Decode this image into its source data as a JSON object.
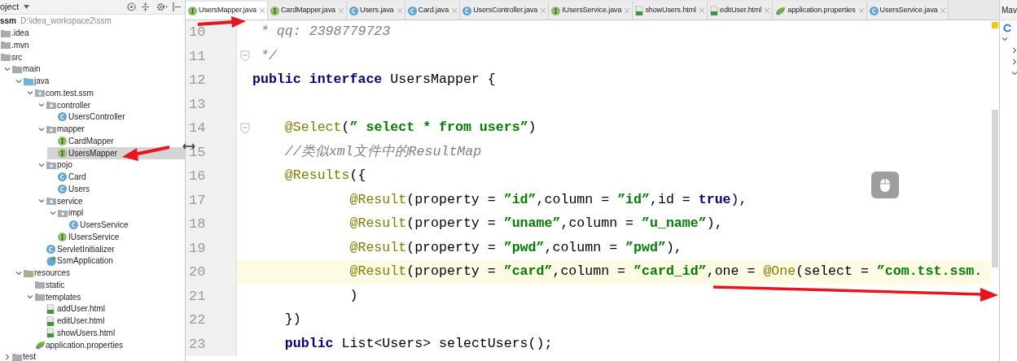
{
  "project_panel": {
    "title": "oject",
    "tree": [
      {
        "label": "ssm",
        "path": "D:\\idea_workspace2\\ssm",
        "kind": "module",
        "selected": false,
        "children": [
          {
            "label": ".idea",
            "kind": "folder",
            "selected": false
          },
          {
            "label": ".mvn",
            "kind": "folder",
            "selected": false
          },
          {
            "label": "src",
            "kind": "folder",
            "selected": false,
            "children": [
              {
                "label": "main",
                "kind": "folder",
                "selected": false,
                "expanded": true,
                "children": [
                  {
                    "label": "java",
                    "kind": "source",
                    "selected": false,
                    "expanded": true,
                    "children": [
                      {
                        "label": "com.test.ssm",
                        "kind": "package",
                        "selected": false,
                        "expanded": true,
                        "children": [
                          {
                            "label": "controller",
                            "kind": "package",
                            "selected": false,
                            "expanded": true,
                            "children": [
                              {
                                "label": "UsersController",
                                "kind": "class",
                                "selected": false
                              }
                            ]
                          },
                          {
                            "label": "mapper",
                            "kind": "package",
                            "selected": false,
                            "expanded": true,
                            "children": [
                              {
                                "label": "CardMapper",
                                "kind": "interface",
                                "selected": false
                              },
                              {
                                "label": "UsersMapper",
                                "kind": "interface",
                                "selected": true
                              }
                            ]
                          },
                          {
                            "label": "pojo",
                            "kind": "package",
                            "selected": false,
                            "expanded": true,
                            "children": [
                              {
                                "label": "Card",
                                "kind": "class",
                                "selected": false
                              },
                              {
                                "label": "Users",
                                "kind": "class",
                                "selected": false
                              }
                            ]
                          },
                          {
                            "label": "service",
                            "kind": "package",
                            "selected": false,
                            "expanded": true,
                            "children": [
                              {
                                "label": "impl",
                                "kind": "package",
                                "selected": false,
                                "expanded": true,
                                "children": [
                                  {
                                    "label": "UsersService",
                                    "kind": "class",
                                    "selected": false
                                  }
                                ]
                              },
                              {
                                "label": "IUsersService",
                                "kind": "interface",
                                "selected": false
                              }
                            ]
                          },
                          {
                            "label": "ServletInitializer",
                            "kind": "class",
                            "selected": false
                          },
                          {
                            "label": "SsmApplication",
                            "kind": "app",
                            "selected": false
                          }
                        ]
                      }
                    ]
                  },
                  {
                    "label": "resources",
                    "kind": "resources",
                    "selected": false,
                    "expanded": true,
                    "children": [
                      {
                        "label": "static",
                        "kind": "folder",
                        "selected": false
                      },
                      {
                        "label": "templates",
                        "kind": "folder",
                        "selected": false,
                        "expanded": true,
                        "children": [
                          {
                            "label": "addUser.html",
                            "kind": "html",
                            "selected": false
                          },
                          {
                            "label": "editUser.html",
                            "kind": "html",
                            "selected": false
                          },
                          {
                            "label": "showUsers.html",
                            "kind": "html",
                            "selected": false
                          }
                        ]
                      },
                      {
                        "label": "application.properties",
                        "kind": "spring",
                        "selected": false
                      }
                    ]
                  }
                ]
              },
              {
                "label": "test",
                "kind": "folder",
                "selected": false,
                "expanded": false
              }
            ]
          }
        ]
      }
    ]
  },
  "editor": {
    "tabs": [
      {
        "label": "UsersMapper.java",
        "kind": "interface",
        "selected": true
      },
      {
        "label": "CardMapper.java",
        "kind": "interface",
        "selected": false
      },
      {
        "label": "Users.java",
        "kind": "class",
        "selected": false
      },
      {
        "label": "Card.java",
        "kind": "class",
        "selected": false
      },
      {
        "label": "UsersController.java",
        "kind": "class",
        "selected": false
      },
      {
        "label": "IUsersService.java",
        "kind": "interface",
        "selected": false
      },
      {
        "label": "showUsers.html",
        "kind": "html",
        "selected": false
      },
      {
        "label": "editUser.html",
        "kind": "html",
        "selected": false
      },
      {
        "label": "application.properties",
        "kind": "spring",
        "selected": false
      },
      {
        "label": "UsersService.java",
        "kind": "class",
        "selected": false
      }
    ],
    "lines": [
      {
        "number": "10",
        "current": false,
        "fold": false,
        "tokens": [
          {
            "text": " * qq: 2398779723",
            "kind": "comment"
          }
        ]
      },
      {
        "number": "11",
        "current": false,
        "fold": true,
        "tokens": [
          {
            "text": " */",
            "kind": "comment"
          }
        ]
      },
      {
        "number": "12",
        "current": false,
        "fold": false,
        "tokens": [
          {
            "text": "public interface",
            "kind": "keyword"
          },
          {
            "text": " UsersMapper {",
            "kind": "plain"
          }
        ]
      },
      {
        "number": "13",
        "current": false,
        "fold": false
      },
      {
        "number": "14",
        "current": false,
        "fold": true,
        "tokens": [
          {
            "text": "    @Select",
            "kind": "annotation"
          },
          {
            "text": "(",
            "kind": "plain"
          },
          {
            "text": "” select * from users”",
            "kind": "string"
          },
          {
            "text": ")",
            "kind": "plain"
          }
        ]
      },
      {
        "number": "15",
        "current": false,
        "fold": false,
        "tokens": [
          {
            "text": "    //类似xml文件中的ResultMap",
            "kind": "comment"
          }
        ]
      },
      {
        "number": "16",
        "current": false,
        "fold": false,
        "tokens": [
          {
            "text": "    @Results",
            "kind": "annotation"
          },
          {
            "text": "({",
            "kind": "plain"
          }
        ]
      },
      {
        "number": "17",
        "current": false,
        "fold": false,
        "tokens": [
          {
            "text": "            @Result",
            "kind": "annotation"
          },
          {
            "text": "(property = ",
            "kind": "plain"
          },
          {
            "text": "”id”",
            "kind": "string"
          },
          {
            "text": ",column = ",
            "kind": "plain"
          },
          {
            "text": "”id”",
            "kind": "string"
          },
          {
            "text": ",id = ",
            "kind": "plain"
          },
          {
            "text": "true",
            "kind": "keyword"
          },
          {
            "text": "),",
            "kind": "plain"
          }
        ]
      },
      {
        "number": "18",
        "current": false,
        "fold": false,
        "tokens": [
          {
            "text": "            @Result",
            "kind": "annotation"
          },
          {
            "text": "(property = ",
            "kind": "plain"
          },
          {
            "text": "”uname”",
            "kind": "string"
          },
          {
            "text": ",column = ",
            "kind": "plain"
          },
          {
            "text": "”u_name”",
            "kind": "string"
          },
          {
            "text": "),",
            "kind": "plain"
          }
        ]
      },
      {
        "number": "19",
        "current": false,
        "fold": false,
        "tokens": [
          {
            "text": "            @Result",
            "kind": "annotation"
          },
          {
            "text": "(property = ",
            "kind": "plain"
          },
          {
            "text": "”pwd”",
            "kind": "string"
          },
          {
            "text": ",column = ",
            "kind": "plain"
          },
          {
            "text": "”pwd”",
            "kind": "string"
          },
          {
            "text": "),",
            "kind": "plain"
          }
        ]
      },
      {
        "number": "20",
        "current": true,
        "fold": false,
        "tokens": [
          {
            "text": "            @Result",
            "kind": "annotation"
          },
          {
            "text": "(property = ",
            "kind": "plain"
          },
          {
            "text": "”card”",
            "kind": "string"
          },
          {
            "text": ",column = ",
            "kind": "plain"
          },
          {
            "text": "”card_id”",
            "kind": "string"
          },
          {
            "text": ",one = ",
            "kind": "plain"
          },
          {
            "text": "@One",
            "kind": "annotation"
          },
          {
            "text": "(select = ",
            "kind": "plain"
          },
          {
            "text": "”com.tst.ssm.",
            "kind": "string"
          }
        ]
      },
      {
        "number": "21",
        "current": false,
        "fold": false,
        "tokens": [
          {
            "text": "            )",
            "kind": "plain"
          }
        ]
      },
      {
        "number": "22",
        "current": false,
        "fold": false,
        "tokens": [
          {
            "text": "    })",
            "kind": "plain"
          }
        ]
      },
      {
        "number": "23",
        "current": false,
        "fold": false,
        "tokens": [
          {
            "text": "    public",
            "kind": "keyword"
          },
          {
            "text": " List<Users> selectUsers();",
            "kind": "plain"
          }
        ]
      }
    ]
  },
  "maven_panel": {
    "title": "Mav"
  }
}
